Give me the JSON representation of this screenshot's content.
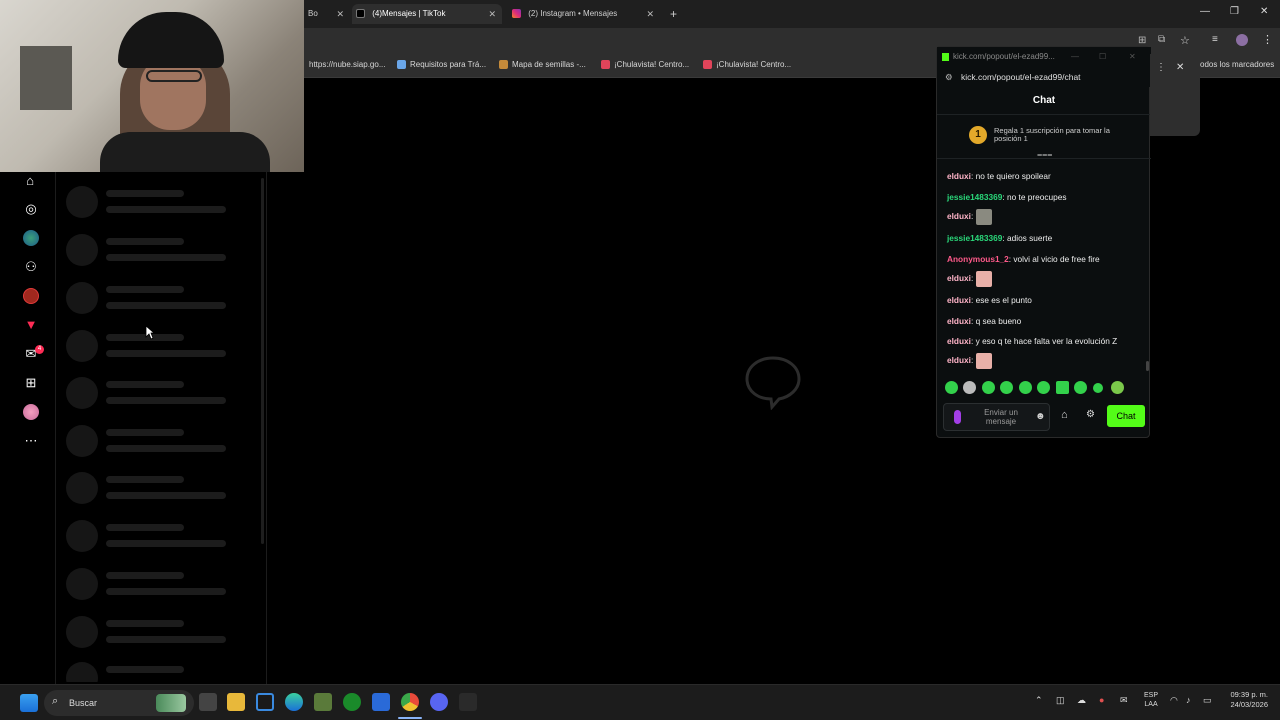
{
  "browser": {
    "tabs": [
      {
        "label": "Bo",
        "favicon": "generic-favicon"
      },
      {
        "label": "(4)Mensajes | TikTok",
        "favicon": "tiktok-favicon",
        "active": true
      },
      {
        "label": "(2) Instagram • Mensajes",
        "favicon": "instagram-favicon"
      }
    ],
    "new_tab": "+",
    "bookmarks": [
      {
        "label": "https://nube.siap.go..."
      },
      {
        "label": "Requisitos para Trá..."
      },
      {
        "label": "Mapa de semillas -..."
      },
      {
        "label": "¡Chulavista! Centro..."
      },
      {
        "label": "¡Chulavista! Centro..."
      }
    ],
    "bookmarks_folder": "odos los marcadores"
  },
  "tiktok": {
    "rail_icons": [
      "home-icon",
      "explore-icon",
      "avatar-icon",
      "following-icon",
      "live-avatar-icon",
      "filter-icon",
      "messages-icon",
      "upload-icon",
      "profile-avatar-icon",
      "more-icon"
    ],
    "messages_badge": "4"
  },
  "popout": {
    "window_title": "kick.com/popout/el-ezad99...",
    "url": "kick.com/popout/el-ezad99/chat",
    "header": "Chat",
    "sub_rank": "1",
    "sub_text": "Regala 1 suscripción para tomar la posición 1",
    "messages": [
      {
        "user": "elduxi",
        "text": "no te quiero spoilear",
        "color": "#ffb4c8"
      },
      {
        "user": "jessie1483369",
        "text": "no te preocupes",
        "color": "#2ad87a"
      },
      {
        "user": "elduxi",
        "text": "",
        "color": "#ffb4c8",
        "emote": "cat-emote"
      },
      {
        "user": "jessie1483369",
        "text": "adios suerte",
        "color": "#2ad87a"
      },
      {
        "user": "Anonymous1_2",
        "text": "volvi al vicio de free fire",
        "color": "#ff5a8a"
      },
      {
        "user": "elduxi",
        "text": "",
        "color": "#ffb4c8",
        "emote": "anime-girl-emote"
      },
      {
        "user": "elduxi",
        "text": "ese es el punto",
        "color": "#ffb4c8"
      },
      {
        "user": "elduxi",
        "text": "q sea bueno",
        "color": "#ffb4c8"
      },
      {
        "user": "elduxi",
        "text": "y eso q te hace falta ver la evolución Z",
        "color": "#ffb4c8"
      },
      {
        "user": "elduxi",
        "text": "",
        "color": "#ffb4c8",
        "emote": "anime-girl-emote"
      }
    ],
    "input_placeholder": "Enviar un mensaje",
    "send_label": "Chat",
    "accent": "#53fc18"
  },
  "taskbar": {
    "search_label": "Buscar",
    "lang": "ESP",
    "lang_sub": "LAA",
    "time": "09:39 p. m.",
    "date": "24/03/2026"
  }
}
